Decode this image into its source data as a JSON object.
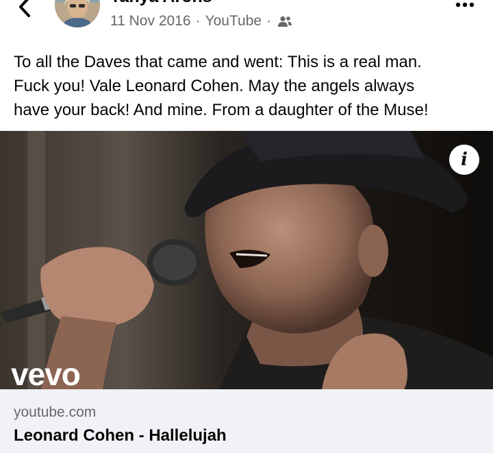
{
  "post": {
    "author": "Tanya Arons",
    "date": "11 Nov 2016",
    "source": "YouTube",
    "separator": "·",
    "audience_icon": "friends-icon",
    "text_lines": [
      "To all the Daves that came and went:  This is a real man.",
      "Fuck you!  Vale Leonard Cohen. May the angels always",
      "have your back!  And mine.  From a daughter of the Muse!"
    ]
  },
  "media": {
    "watermark": "vevo",
    "info_label": "i"
  },
  "link_preview": {
    "domain": "youtube.com",
    "title": "Leonard Cohen - Hallelujah"
  },
  "colors": {
    "text_primary": "#050505",
    "text_secondary": "#65676b",
    "card_background": "#f0f2f5"
  }
}
